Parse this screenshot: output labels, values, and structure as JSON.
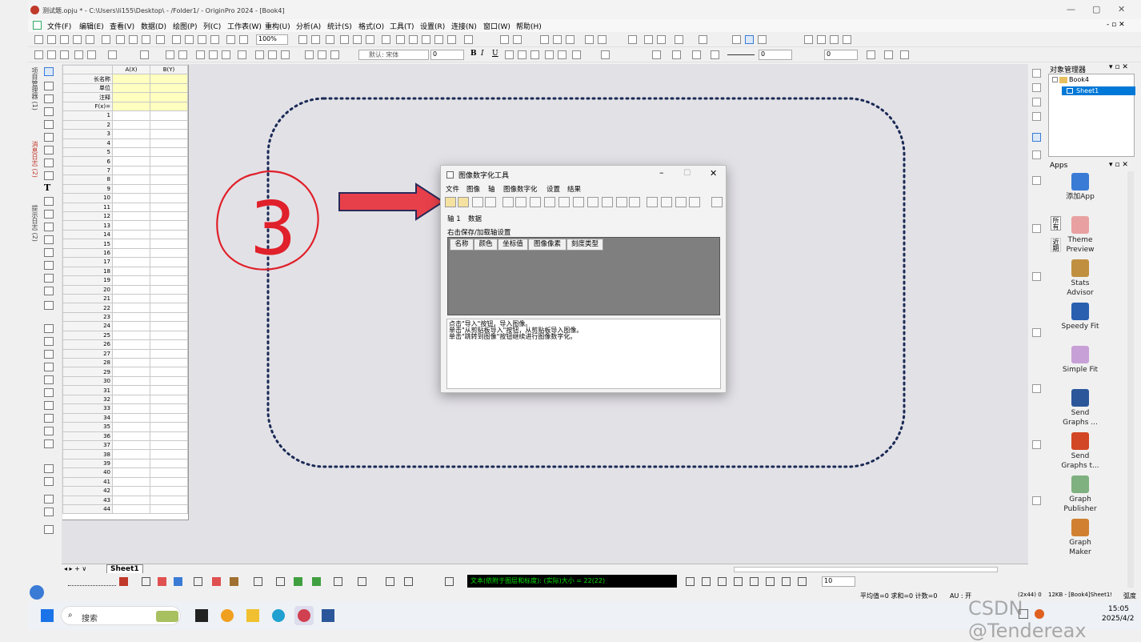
{
  "title": "测试题.opju * - C:\\Users\\li155\\Desktop\\ - /Folder1/ - OriginPro 2024 - [Book4]",
  "window_controls": {
    "minimize": "—",
    "restore": "▢",
    "close": "✕"
  },
  "menu": [
    "文件(F)",
    "编辑(E)",
    "查看(V)",
    "数据(D)",
    "绘图(P)",
    "列(C)",
    "工作表(W)",
    "重构(U)",
    "分析(A)",
    "统计(S)",
    "格式(O)",
    "工具(T)",
    "设置(R)",
    "连接(N)",
    "窗口(W)",
    "帮助(H)"
  ],
  "toolbar": {
    "zoom": "100%",
    "font": "默认: 宋体",
    "size": "0",
    "line_w": "0",
    "line_w2": "0"
  },
  "left_tabs": [
    "项目管理器 (1)",
    "消息日志 (2)",
    "提示日志 (2)"
  ],
  "sheet": {
    "headers": [
      "A(X)",
      "B(Y)"
    ],
    "meta_rows": [
      "长名称",
      "单位",
      "注释",
      "F(x)="
    ],
    "rows": [
      "1",
      "2",
      "3",
      "4",
      "5",
      "6",
      "7",
      "8",
      "9",
      "10",
      "11",
      "12",
      "13",
      "14",
      "15",
      "16",
      "17",
      "18",
      "19",
      "20",
      "21",
      "22",
      "23",
      "24",
      "25",
      "26",
      "27",
      "28",
      "29",
      "30",
      "31",
      "32",
      "33",
      "34",
      "35",
      "36",
      "37",
      "38",
      "39",
      "40",
      "41",
      "42",
      "43",
      "44"
    ],
    "tab": "Sheet1"
  },
  "annotation": {
    "number": "3"
  },
  "dialog": {
    "title": "图像数字化工具",
    "menu": [
      "文件",
      "图像",
      "轴",
      "图像数字化",
      "设置",
      "结果"
    ],
    "tabs": [
      "轴 1",
      "数据"
    ],
    "hint": "右击保存/加载轴设置",
    "columns": [
      "名称",
      "颜色",
      "坐标值",
      "图像像素",
      "刻度类型"
    ],
    "messages": [
      "点击\"导入\"按钮，导入图像。",
      "单击\"从剪贴板导入\"按钮，从剪贴板导入图像。",
      "单击\"跳转到图像\"按钮继续进行图像数字化。"
    ]
  },
  "bottom_toolbar": {
    "text_box": "文本(依附于图层和标度): (实际)大小 = 22(22)",
    "size_value": "10"
  },
  "status_bar": {
    "stats": "平均值=0 求和=0 计数=0",
    "au": "AU : 开",
    "dims": "(2x44) 0",
    "info": "12KB - [Book4]Sheet1!",
    "unit": "弧度"
  },
  "object_manager": {
    "title": "对象管理器",
    "book": "Book4",
    "sheet": "Sheet1"
  },
  "apps": {
    "title": "Apps",
    "side_tabs": [
      "所有",
      "近期"
    ],
    "items": [
      {
        "name": "添加App",
        "icon": "add-app-icon",
        "color": "#3a7bd5"
      },
      {
        "name": "Theme Preview",
        "icon": "theme-preview-icon",
        "color": "#e8a0a0"
      },
      {
        "name": "Stats Advisor",
        "icon": "stats-advisor-icon",
        "color": "#c09040"
      },
      {
        "name": "Speedy Fit",
        "icon": "speedy-fit-icon",
        "color": "#2a5fb0"
      },
      {
        "name": "Simple Fit",
        "icon": "simple-fit-icon",
        "color": "#c8a0d8"
      },
      {
        "name": "Send Graphs ...",
        "icon": "send-word-icon",
        "color": "#2b579a"
      },
      {
        "name": "Send Graphs t...",
        "icon": "send-ppt-icon",
        "color": "#d24726"
      },
      {
        "name": "Graph Publisher",
        "icon": "graph-publisher-icon",
        "color": "#7fb07f"
      },
      {
        "name": "Graph Maker",
        "icon": "graph-maker-icon",
        "color": "#d08030"
      }
    ]
  },
  "taskbar": {
    "search": "搜索",
    "time": "15:05",
    "date": "2025/4/2",
    "watermark": "CSDN @Tendereax"
  }
}
